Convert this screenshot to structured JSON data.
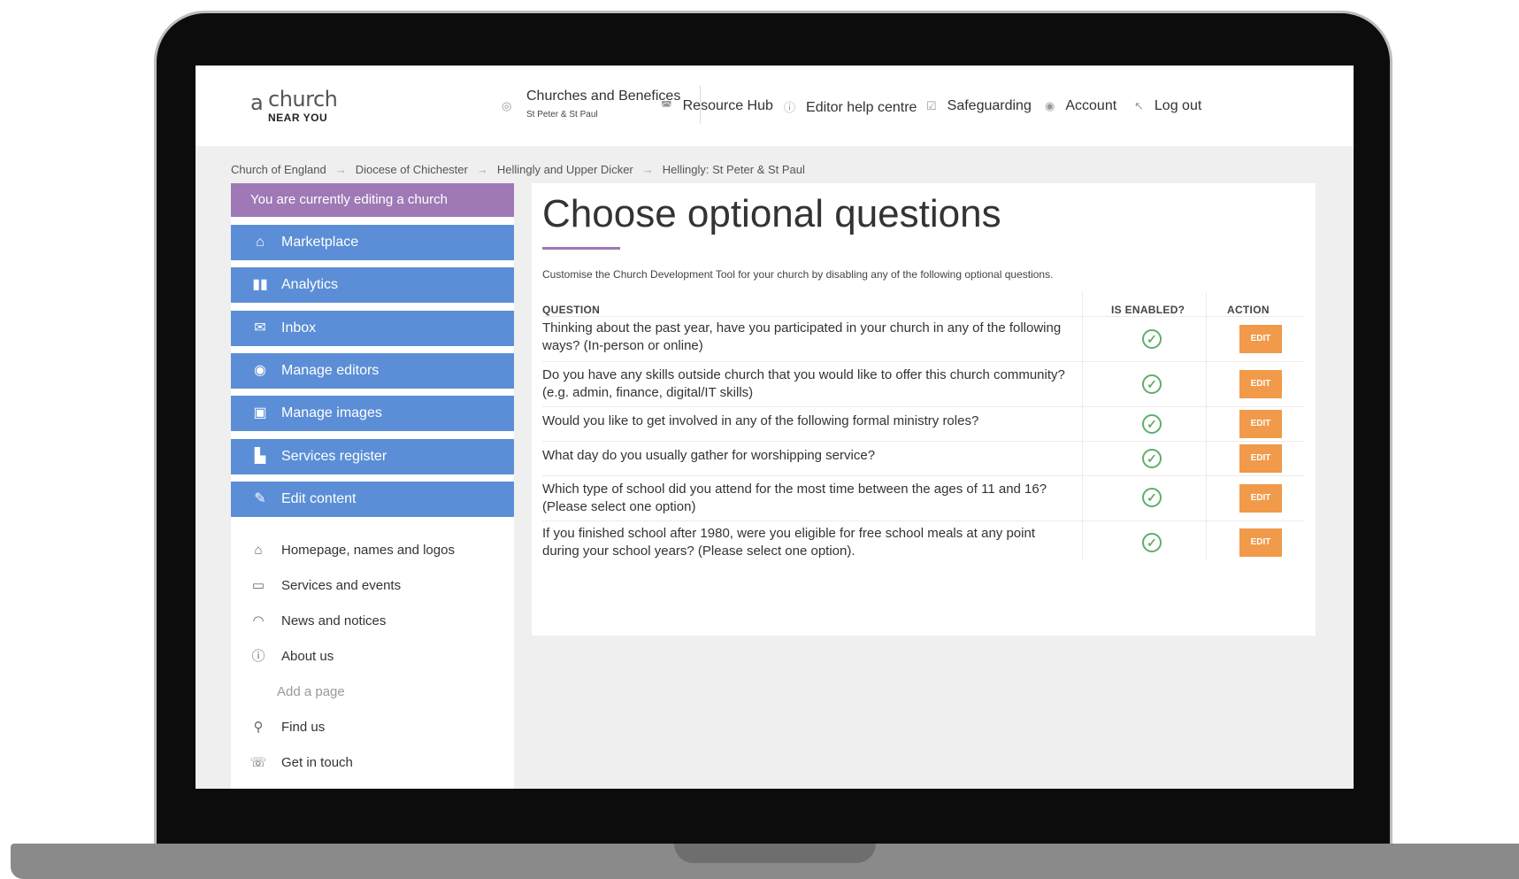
{
  "header": {
    "logo": {
      "prefix": "a",
      "word": "church",
      "tagline": "NEAR YOU"
    },
    "church": {
      "title": "Churches and Benefices",
      "subtitle": "St Peter & St Paul"
    },
    "links": [
      {
        "label": "Resource Hub",
        "icon": "book-icon"
      },
      {
        "label": "Editor help centre",
        "icon": "help-icon"
      },
      {
        "label": "Safeguarding",
        "icon": "checkbox-icon"
      },
      {
        "label": "Account",
        "icon": "user-icon"
      },
      {
        "label": "Log out",
        "icon": "logout-icon"
      }
    ]
  },
  "breadcrumb": [
    "Church of England",
    "Diocese of Chichester",
    "Hellingly and Upper Dicker",
    "Hellingly: St Peter & St Paul"
  ],
  "sidebar": {
    "editing_notice": "You are currently editing a church",
    "menu": [
      {
        "label": "Marketplace",
        "icon": "basket-icon"
      },
      {
        "label": "Analytics",
        "icon": "bar-chart-icon"
      },
      {
        "label": "Inbox",
        "icon": "envelope-icon"
      },
      {
        "label": "Manage editors",
        "icon": "user-circle-icon"
      },
      {
        "label": "Manage images",
        "icon": "images-icon"
      },
      {
        "label": "Services register",
        "icon": "file-icon"
      },
      {
        "label": "Edit content",
        "icon": "pencil-icon"
      }
    ],
    "sub_items": [
      {
        "label": "Homepage, names and logos",
        "icon": "home-icon"
      },
      {
        "label": "Services and events",
        "icon": "calendar-icon"
      },
      {
        "label": "News and notices",
        "icon": "broadcast-icon"
      },
      {
        "label": "About us",
        "icon": "info-icon"
      },
      {
        "label": "Add a page",
        "icon": ""
      },
      {
        "label": "Find us",
        "icon": "map-pin-icon"
      },
      {
        "label": "Get in touch",
        "icon": "phone-icon"
      }
    ]
  },
  "main": {
    "title": "Choose optional questions",
    "intro": "Customise the Church Development Tool for your church by disabling any of the following optional questions.",
    "columns": {
      "question": "QUESTION",
      "enabled": "IS ENABLED?",
      "action": "ACTION"
    },
    "rows": [
      {
        "question": "Thinking about the past year, have you participated in your church in any of the following ways? (In-person or online)",
        "enabled": true,
        "action": "EDIT"
      },
      {
        "question": "Do you have any skills outside church that you would like to offer this church community? (e.g. admin, finance, digital/IT skills)",
        "enabled": true,
        "action": "EDIT"
      },
      {
        "question": "Would you like to get involved in any of the following formal ministry roles?",
        "enabled": true,
        "action": "EDIT"
      },
      {
        "question": "What day do you usually gather for worshipping service?",
        "enabled": true,
        "action": "EDIT"
      },
      {
        "question": "Which type of school did you attend for the most time between the ages of 11 and 16? (Please select one option)",
        "enabled": true,
        "action": "EDIT"
      },
      {
        "question": "If you finished school after 1980, were you eligible for free school meals at any point during your school years? (Please select one option).",
        "enabled": true,
        "action": "EDIT"
      }
    ]
  },
  "colors": {
    "accent_purple": "#9e79b6",
    "menu_blue": "#5b8ed6",
    "edit_orange": "#f09a4a",
    "check_green": "#5fae6a"
  }
}
